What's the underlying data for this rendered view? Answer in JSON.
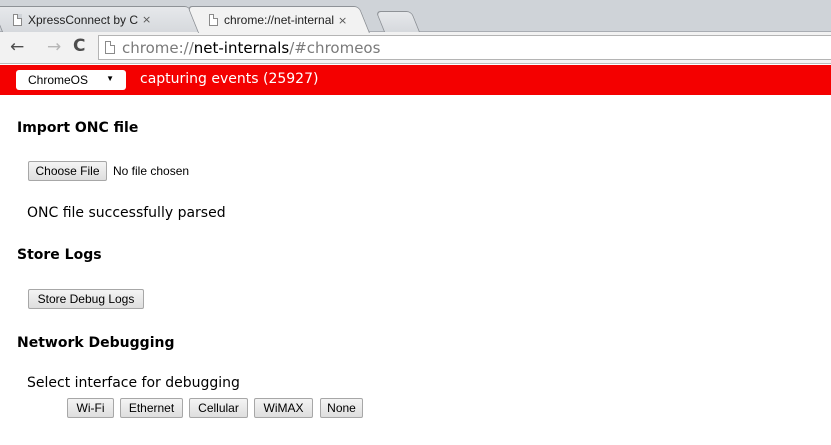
{
  "tabs": [
    {
      "title": "XpressConnect by Cloud",
      "close": "×",
      "active": false
    },
    {
      "title": "chrome://net-internals/#",
      "close": "×",
      "active": true
    }
  ],
  "toolbar": {
    "back_glyph": "←",
    "forward_glyph": "→",
    "reload_glyph": "C",
    "url_scheme": "chrome://",
    "url_host": "net-internals",
    "url_path": "/#chromeos"
  },
  "statusbar": {
    "view_select_value": "ChromeOS",
    "select_arrow": "▼",
    "status_text": "capturing events (25927)",
    "bg_color": "#f40000"
  },
  "import_onc": {
    "heading": "Import ONC file",
    "choose_file_label": "Choose File",
    "no_file_text": "No file chosen",
    "parse_status": "ONC file successfully parsed"
  },
  "store_logs": {
    "heading": "Store Logs",
    "button_label": "Store Debug Logs"
  },
  "network_debugging": {
    "heading": "Network Debugging",
    "prompt": "Select interface for debugging",
    "interfaces": [
      "Wi-Fi",
      "Ethernet",
      "Cellular",
      "WiMAX",
      "None"
    ]
  }
}
